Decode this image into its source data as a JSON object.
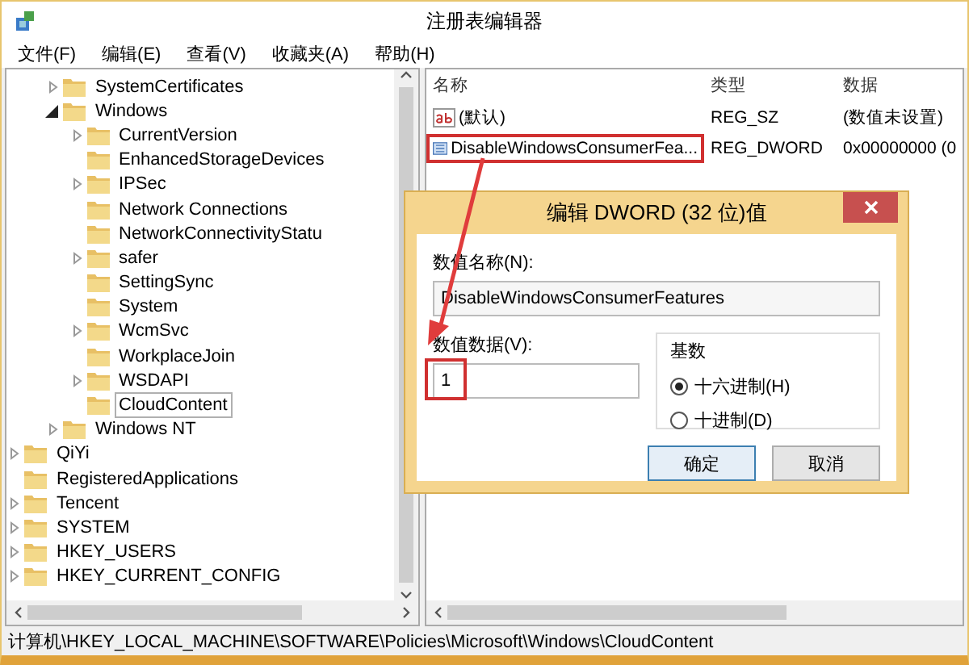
{
  "window": {
    "title": "注册表编辑器"
  },
  "menu": [
    "文件(F)",
    "编辑(E)",
    "查看(V)",
    "收藏夹(A)",
    "帮助(H)"
  ],
  "tree": [
    {
      "children": [
        {
          "children": [
            {
              "children": [
                {
                  "children": [
                    {
                      "label": "SystemCertificates",
                      "has_children": true,
                      "expanded": false,
                      "selected": false
                    },
                    {
                      "label": "Windows",
                      "has_children": true,
                      "expanded": true,
                      "selected": false,
                      "children": [
                        {
                          "label": "CurrentVersion",
                          "has_children": true,
                          "expanded": false,
                          "selected": false
                        },
                        {
                          "label": "EnhancedStorageDevices",
                          "has_children": false,
                          "expanded": false,
                          "selected": false
                        },
                        {
                          "label": "IPSec",
                          "has_children": true,
                          "expanded": false,
                          "selected": false
                        },
                        {
                          "label": "Network Connections",
                          "has_children": false,
                          "expanded": false,
                          "selected": false
                        },
                        {
                          "label": "NetworkConnectivityStatu",
                          "has_children": false,
                          "expanded": false,
                          "selected": false
                        },
                        {
                          "label": "safer",
                          "has_children": true,
                          "expanded": false,
                          "selected": false
                        },
                        {
                          "label": "SettingSync",
                          "has_children": false,
                          "expanded": false,
                          "selected": false
                        },
                        {
                          "label": "System",
                          "has_children": false,
                          "expanded": false,
                          "selected": false
                        },
                        {
                          "label": "WcmSvc",
                          "has_children": true,
                          "expanded": false,
                          "selected": false
                        },
                        {
                          "label": "WorkplaceJoin",
                          "has_children": false,
                          "expanded": false,
                          "selected": false
                        },
                        {
                          "label": "WSDAPI",
                          "has_children": true,
                          "expanded": false,
                          "selected": false
                        },
                        {
                          "label": "CloudContent",
                          "has_children": false,
                          "expanded": false,
                          "selected": true
                        }
                      ]
                    },
                    {
                      "label": "Windows NT",
                      "has_children": true,
                      "expanded": false,
                      "selected": false
                    }
                  ]
                }
              ]
            },
            {
              "label": "QiYi",
              "has_children": true,
              "expanded": false,
              "selected": false
            },
            {
              "label": "RegisteredApplications",
              "has_children": false,
              "expanded": false,
              "selected": false
            },
            {
              "label": "Tencent",
              "has_children": true,
              "expanded": false,
              "selected": false
            }
          ]
        },
        {
          "label": "SYSTEM",
          "has_children": true,
          "expanded": false,
          "selected": false
        }
      ]
    },
    {
      "label": "HKEY_USERS",
      "has_children": true,
      "expanded": false,
      "selected": false
    },
    {
      "label": "HKEY_CURRENT_CONFIG",
      "has_children": true,
      "expanded": false,
      "selected": false
    }
  ],
  "list": {
    "columns": [
      "名称",
      "类型",
      "数据"
    ],
    "rows": [
      {
        "kind": "string",
        "name": "(默认)",
        "type": "REG_SZ",
        "data": "(数值未设置)",
        "highlighted": false
      },
      {
        "kind": "dword",
        "name": "DisableWindowsConsumerFea...",
        "type": "REG_DWORD",
        "data": "0x00000000 (0",
        "highlighted": true
      }
    ]
  },
  "dialog": {
    "title": "编辑 DWORD (32 位)值",
    "name_label": "数值名称(N):",
    "name_value": "DisableWindowsConsumerFeatures",
    "data_label": "数值数据(V):",
    "data_value": "1",
    "data_highlighted": true,
    "base_label": "基数",
    "bases": [
      {
        "label": "十六进制(H)",
        "selected": true
      },
      {
        "label": "十进制(D)",
        "selected": false
      }
    ],
    "buttons": [
      {
        "label": "确定",
        "default": true
      },
      {
        "label": "取消",
        "default": false
      }
    ]
  },
  "status_bar": "计算机\\HKEY_LOCAL_MACHINE\\SOFTWARE\\Policies\\Microsoft\\Windows\\CloudContent"
}
